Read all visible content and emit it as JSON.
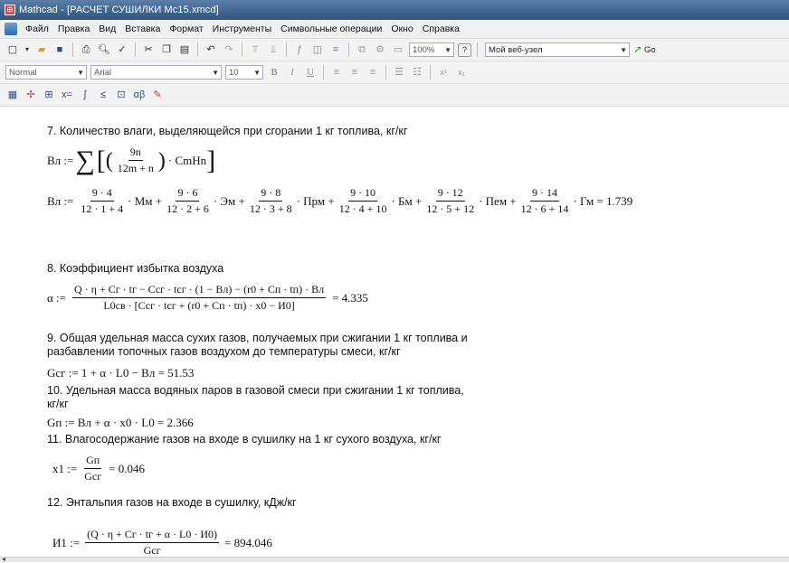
{
  "window": {
    "title": "Mathcad - [РАСЧЕТ СУШИЛКИ Mc15.xmcd]"
  },
  "menu": [
    "Файл",
    "Правка",
    "Вид",
    "Вставка",
    "Формат",
    "Инструменты",
    "Символьные операции",
    "Окно",
    "Справка"
  ],
  "toolbar": {
    "zoom": "100%",
    "web_combo": "Мой веб-узел",
    "go_label": "Go"
  },
  "format_bar": {
    "style": "Normal",
    "font": "Arial",
    "size": "10"
  },
  "sections": {
    "s7": {
      "heading": "7. Количество влаги, выделяющейся при сгорании 1 кг топлива, кг/кг",
      "def_lhs": "Вл :=",
      "def_num": "9n",
      "def_den": "12m + n",
      "def_tail": "· CmHn",
      "eval_lhs": "Вл :=",
      "terms": [
        {
          "num": "9 · 4",
          "den": "12 · 1 + 4",
          "var": "· Мм +"
        },
        {
          "num": "9 · 6",
          "den": "12 · 2 + 6",
          "var": "· Эм +"
        },
        {
          "num": "9 · 8",
          "den": "12 · 3 + 8",
          "var": "· Прм +"
        },
        {
          "num": "9 · 10",
          "den": "12 · 4 + 10",
          "var": "· Бм +"
        },
        {
          "num": "9 · 12",
          "den": "12 · 5 + 12",
          "var": "· Пем +"
        },
        {
          "num": "9 · 14",
          "den": "12 · 6 + 14",
          "var": "· Гм = 1.739"
        }
      ]
    },
    "s8": {
      "heading": "8. Коэффициент избытка воздуха",
      "lhs": "α :=",
      "num": "Q · η + Сг · tг − Ссг · tсг · (1 − Вл) − (r0 + Сп · tп) · Вл",
      "den": "L0св · [Ссг · tсг + (r0 + Сп · tп) · x0 − И0]",
      "result": "= 4.335"
    },
    "s9": {
      "heading_line1": "9. Общая удельная масса сухих газов, получаемых при сжигании 1 кг топлива и",
      "heading_line2": "разбавлении топочных газов воздухом до температуры смеси, кг/кг",
      "formula": "Gсг := 1 + α · L0 − Вл = 51.53"
    },
    "s10": {
      "heading_line1": "10. Удельная масса водяных паров в газовой смеси при сжигании 1 кг топлива,",
      "heading_line2": "кг/кг",
      "formula": "Gп := Вл + α · x0 · L0 = 2.366"
    },
    "s11": {
      "heading": "11. Влагосодержание газов на входе в сушилку на 1 кг сухого воздуха, кг/кг",
      "lhs": "x1 :=",
      "num": "Gп",
      "den": "Gсг",
      "result": "= 0.046"
    },
    "s12": {
      "heading": "12. Энтальпия газов на входе в сушилку, кДж/кг",
      "lhs": "И1 :=",
      "num": "(Q · η + Сг · tг + α · L0 · И0)",
      "den": "Gсг",
      "result": "= 894.046"
    }
  }
}
